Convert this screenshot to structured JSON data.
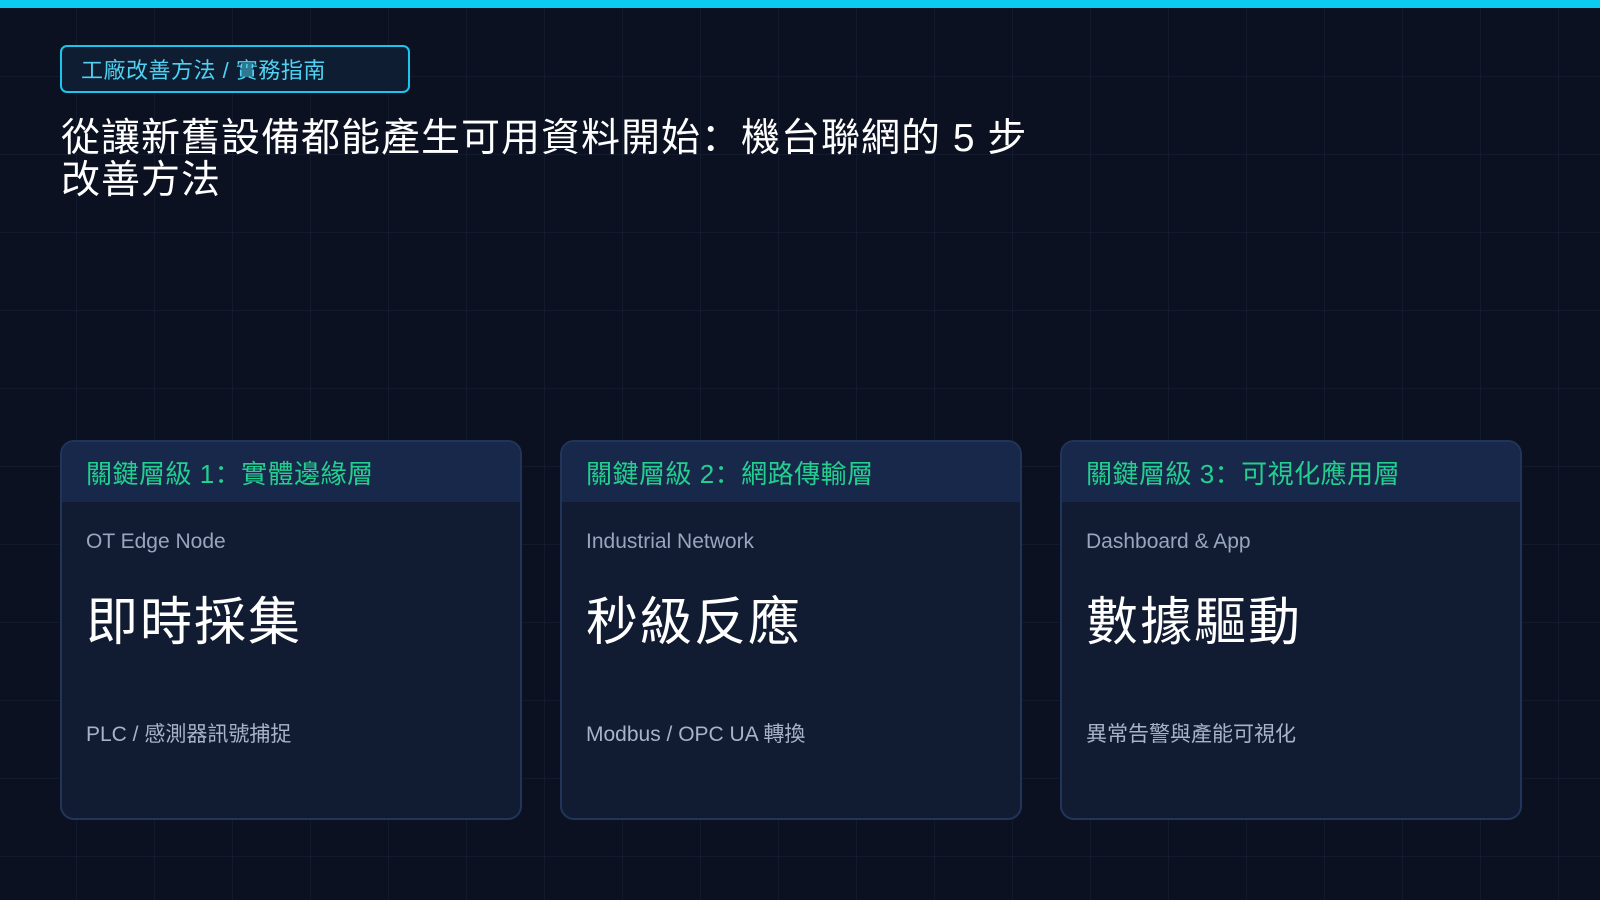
{
  "tag": "工廠改善方法 / 實務指南",
  "title": "從讓新舊設備都能產生可用資料開始：機台聯網的 5 步改善方法",
  "colors": {
    "accent_bar": "#0bcbf0",
    "tag_border": "#19c6ee",
    "header_text": "#22cf8f",
    "background": "#0b1120"
  },
  "cards": [
    {
      "header": "關鍵層級 1：實體邊緣層",
      "subtitle": "OT Edge Node",
      "metric": "即時採集",
      "description": "PLC / 感測器訊號捕捉"
    },
    {
      "header": "關鍵層級 2：網路傳輸層",
      "subtitle": "Industrial Network",
      "metric": "秒級反應",
      "description": "Modbus / OPC UA 轉換"
    },
    {
      "header": "關鍵層級 3：可視化應用層",
      "subtitle": "Dashboard & App",
      "metric": "數據驅動",
      "description": "異常告警與產能可視化"
    }
  ]
}
